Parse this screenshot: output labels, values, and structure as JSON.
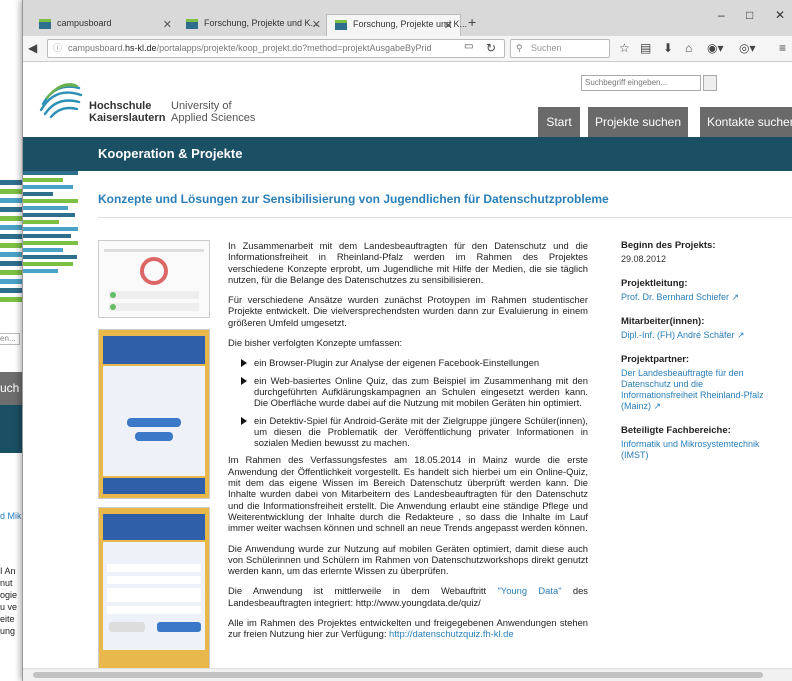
{
  "background_window": {
    "search_placeholder": "en...",
    "nav_fragment": "uch",
    "link_fragment": "d Mik",
    "text_lines": [
      "I An",
      "nut",
      "ogie",
      "u ve",
      "eite",
      "ung"
    ]
  },
  "browser": {
    "tabs": [
      {
        "label": "campusboard"
      },
      {
        "label": "Forschung, Projekte und K..."
      },
      {
        "label": "Forschung, Projekte und K..."
      }
    ],
    "new_tab": "+",
    "url_prefix": "campusboard.",
    "url_domain": "hs-kl.de",
    "url_path": "/portalapps/projekte/koop_projekt.do?method=projektAusgabeByPrid",
    "search_placeholder": "Suchen"
  },
  "site": {
    "search_placeholder": "Suchbegriff eingeben...",
    "logo_de_line1": "Hochschule",
    "logo_de_line2": "Kaiserslautern",
    "logo_en_line1": "University of",
    "logo_en_line2": "Applied Sciences",
    "nav": [
      "Start",
      "Projekte suchen",
      "Kontakte suchen"
    ],
    "section": "Kooperation & Projekte",
    "colors": {
      "teal": "#1b4f64",
      "link": "#2a7fb8",
      "green": "#7bc043",
      "blue": "#2e6f8e"
    }
  },
  "content": {
    "title": "Konzepte und Lösungen zur Sensibilisierung von Jugendlichen für Datenschutzprobleme",
    "p1": "In Zusammenarbeit mit dem Landesbeauftragten für den Datenschutz und die Informationsfreiheit in Rheinland-Pfalz werden im Rahmen des Projektes verschiedene Konzepte erprobt, um Jugendliche mit Hilfe der Medien, die sie täglich nutzen, für die Belange des Datenschutzes zu sensibilisieren.",
    "p2": "Für verschiedene Ansätze wurden zunächst Protoypen im Rahmen studentischer Projekte entwickelt. Die vielversprechendsten wurden dann zur Evaluierung in einem größeren Umfeld umgesetzt.",
    "p3": "Die bisher verfolgten Konzepte umfassen:",
    "bullets": [
      "ein Browser-Plugin zur Analyse der eigenen Facebook-Einstellungen",
      "ein Web-basiertes Online Quiz, das zum Beispiel im Zusammenhang mit den durchgeführten Aufklärungskampagnen an Schulen eingesetzt werden kann. Die Oberfläche wurde dabei auf die Nutzung mit mobilen Geräten hin optimiert.",
      "ein Detektiv-Spiel für Android-Geräte mit der Zielgruppe jüngere Schüler(innen), um diesen die Problematik der Veröffentlichung privater Informationen in sozialen Medien bewusst zu machen."
    ],
    "p4": "Im Rahmen des Verfassungsfestes am 18.05.2014 in Mainz wurde die erste Anwendung der Öffentlichkeit vorgestellt. Es handelt sich hierbei um ein Online-Quiz, mit dem das eigene Wissen im Bereich Datenschutz überprüft werden kann. Die Inhalte wurden dabei von Mitarbeitern des Landesbeauftragten für den Datenschutz und die Informationsfreiheit erstellt. Die Anwendung erlaubt eine ständige Pflege und Weiterentwicklung der Inhalte durch die Redakteure , so dass die Inhalte im Lauf immer weiter wachsen können und schnell an neue Trends angepasst werden können.",
    "p5": "Die Anwendung wurde zur Nutzung auf mobilen Geräten optimiert, damit diese auch von Schülerinnen und Schülern im Rahmen von Datenschutzworkshops direkt genutzt werden kann, um das erlernte Wissen zu überprüfen.",
    "p6_a": "Die Anwendung ist mittlerweile in dem Webauftritt ",
    "p6_link": "\"Young Data\"",
    "p6_b": " des Landesbeauftragten integriert: http://www.youngdata.de/quiz/",
    "p7_a": "Alle im Rahmen des Projektes entwickelten und freigegebenen Anwendungen stehen zur freien Nutzung hier zur Verfügung: ",
    "p7_link": "http://datenschutzquiz.fh-kl.de"
  },
  "sidebar": {
    "start_label": "Beginn des Projekts:",
    "start_value": "29.08.2012",
    "lead_label": "Projektleitung:",
    "lead_value": "Prof. Dr. Bernhard Schiefer ↗",
    "staff_label": "Mitarbeiter(innen):",
    "staff_value": "Dipl.-Inf. (FH) André Schäfer ↗",
    "partner_label": "Projektpartner:",
    "partner_value": "Der Landesbeauftragte für den Datenschutz und die Informationsfreiheit Rheinland-Pfalz (Mainz) ↗",
    "dept_label": "Beteiligte Fachbereiche:",
    "dept_value": "Informatik und Mikrosystemtechnik (IMST)"
  }
}
